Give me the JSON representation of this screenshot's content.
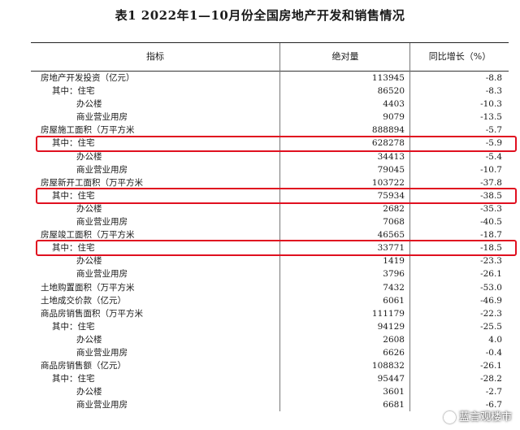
{
  "title": "表1 2022年1—10月份全国房地产开发和销售情况",
  "headers": {
    "indicator": "指标",
    "absolute": "绝对量",
    "yoy": "同比增长（%）"
  },
  "rows": [
    {
      "label": "房地产开发投资（亿元）",
      "indent": 0,
      "value": "113945",
      "yoy": "-8.8"
    },
    {
      "label": "其中：住宅",
      "indent": 1,
      "value": "86520",
      "yoy": "-8.3"
    },
    {
      "label": "办公楼",
      "indent": 2,
      "value": "4403",
      "yoy": "-10.3"
    },
    {
      "label": "商业营业用房",
      "indent": 2,
      "value": "9079",
      "yoy": "-13.5"
    },
    {
      "label": "房屋施工面积（万平方米",
      "indent": 0,
      "value": "888894",
      "yoy": "-5.7"
    },
    {
      "label": "其中：住宅",
      "indent": 1,
      "value": "628278",
      "yoy": "-5.9"
    },
    {
      "label": "办公楼",
      "indent": 2,
      "value": "34413",
      "yoy": "-5.4"
    },
    {
      "label": "商业营业用房",
      "indent": 2,
      "value": "79045",
      "yoy": "-10.7"
    },
    {
      "label": "房屋新开工面积（万平方米",
      "indent": 0,
      "value": "103722",
      "yoy": "-37.8"
    },
    {
      "label": "其中：住宅",
      "indent": 1,
      "value": "75934",
      "yoy": "-38.5"
    },
    {
      "label": "办公楼",
      "indent": 2,
      "value": "2682",
      "yoy": "-35.3"
    },
    {
      "label": "商业营业用房",
      "indent": 2,
      "value": "7068",
      "yoy": "-40.5"
    },
    {
      "label": "房屋竣工面积（万平方米",
      "indent": 0,
      "value": "46565",
      "yoy": "-18.7"
    },
    {
      "label": "其中：住宅",
      "indent": 1,
      "value": "33771",
      "yoy": "-18.5"
    },
    {
      "label": "办公楼",
      "indent": 2,
      "value": "1419",
      "yoy": "-23.3"
    },
    {
      "label": "商业营业用房",
      "indent": 2,
      "value": "3796",
      "yoy": "-26.1"
    },
    {
      "label": "土地购置面积（万平方米",
      "indent": 0,
      "value": "7432",
      "yoy": "-53.0"
    },
    {
      "label": "土地成交价款（亿元）",
      "indent": 0,
      "value": "6061",
      "yoy": "-46.9"
    },
    {
      "label": "商品房销售面积（万平方米",
      "indent": 0,
      "value": "111179",
      "yoy": "-22.3"
    },
    {
      "label": "其中：住宅",
      "indent": 1,
      "value": "94129",
      "yoy": "-25.5"
    },
    {
      "label": "办公楼",
      "indent": 2,
      "value": "2608",
      "yoy": "4.0"
    },
    {
      "label": "商业营业用房",
      "indent": 2,
      "value": "6626",
      "yoy": "-0.4"
    },
    {
      "label": "商品房销售额（亿元）",
      "indent": 0,
      "value": "108832",
      "yoy": "-26.1"
    },
    {
      "label": "其中：住宅",
      "indent": 1,
      "value": "95447",
      "yoy": "-28.2"
    },
    {
      "label": "办公楼",
      "indent": 2,
      "value": "3601",
      "yoy": "-2.7"
    },
    {
      "label": "商业营业用房",
      "indent": 2,
      "value": "6681",
      "yoy": "-6.7"
    }
  ],
  "highlighted_rows": [
    5,
    9,
    13
  ],
  "highlight_color": "#e01020",
  "watermark": "蓝言观楼市"
}
